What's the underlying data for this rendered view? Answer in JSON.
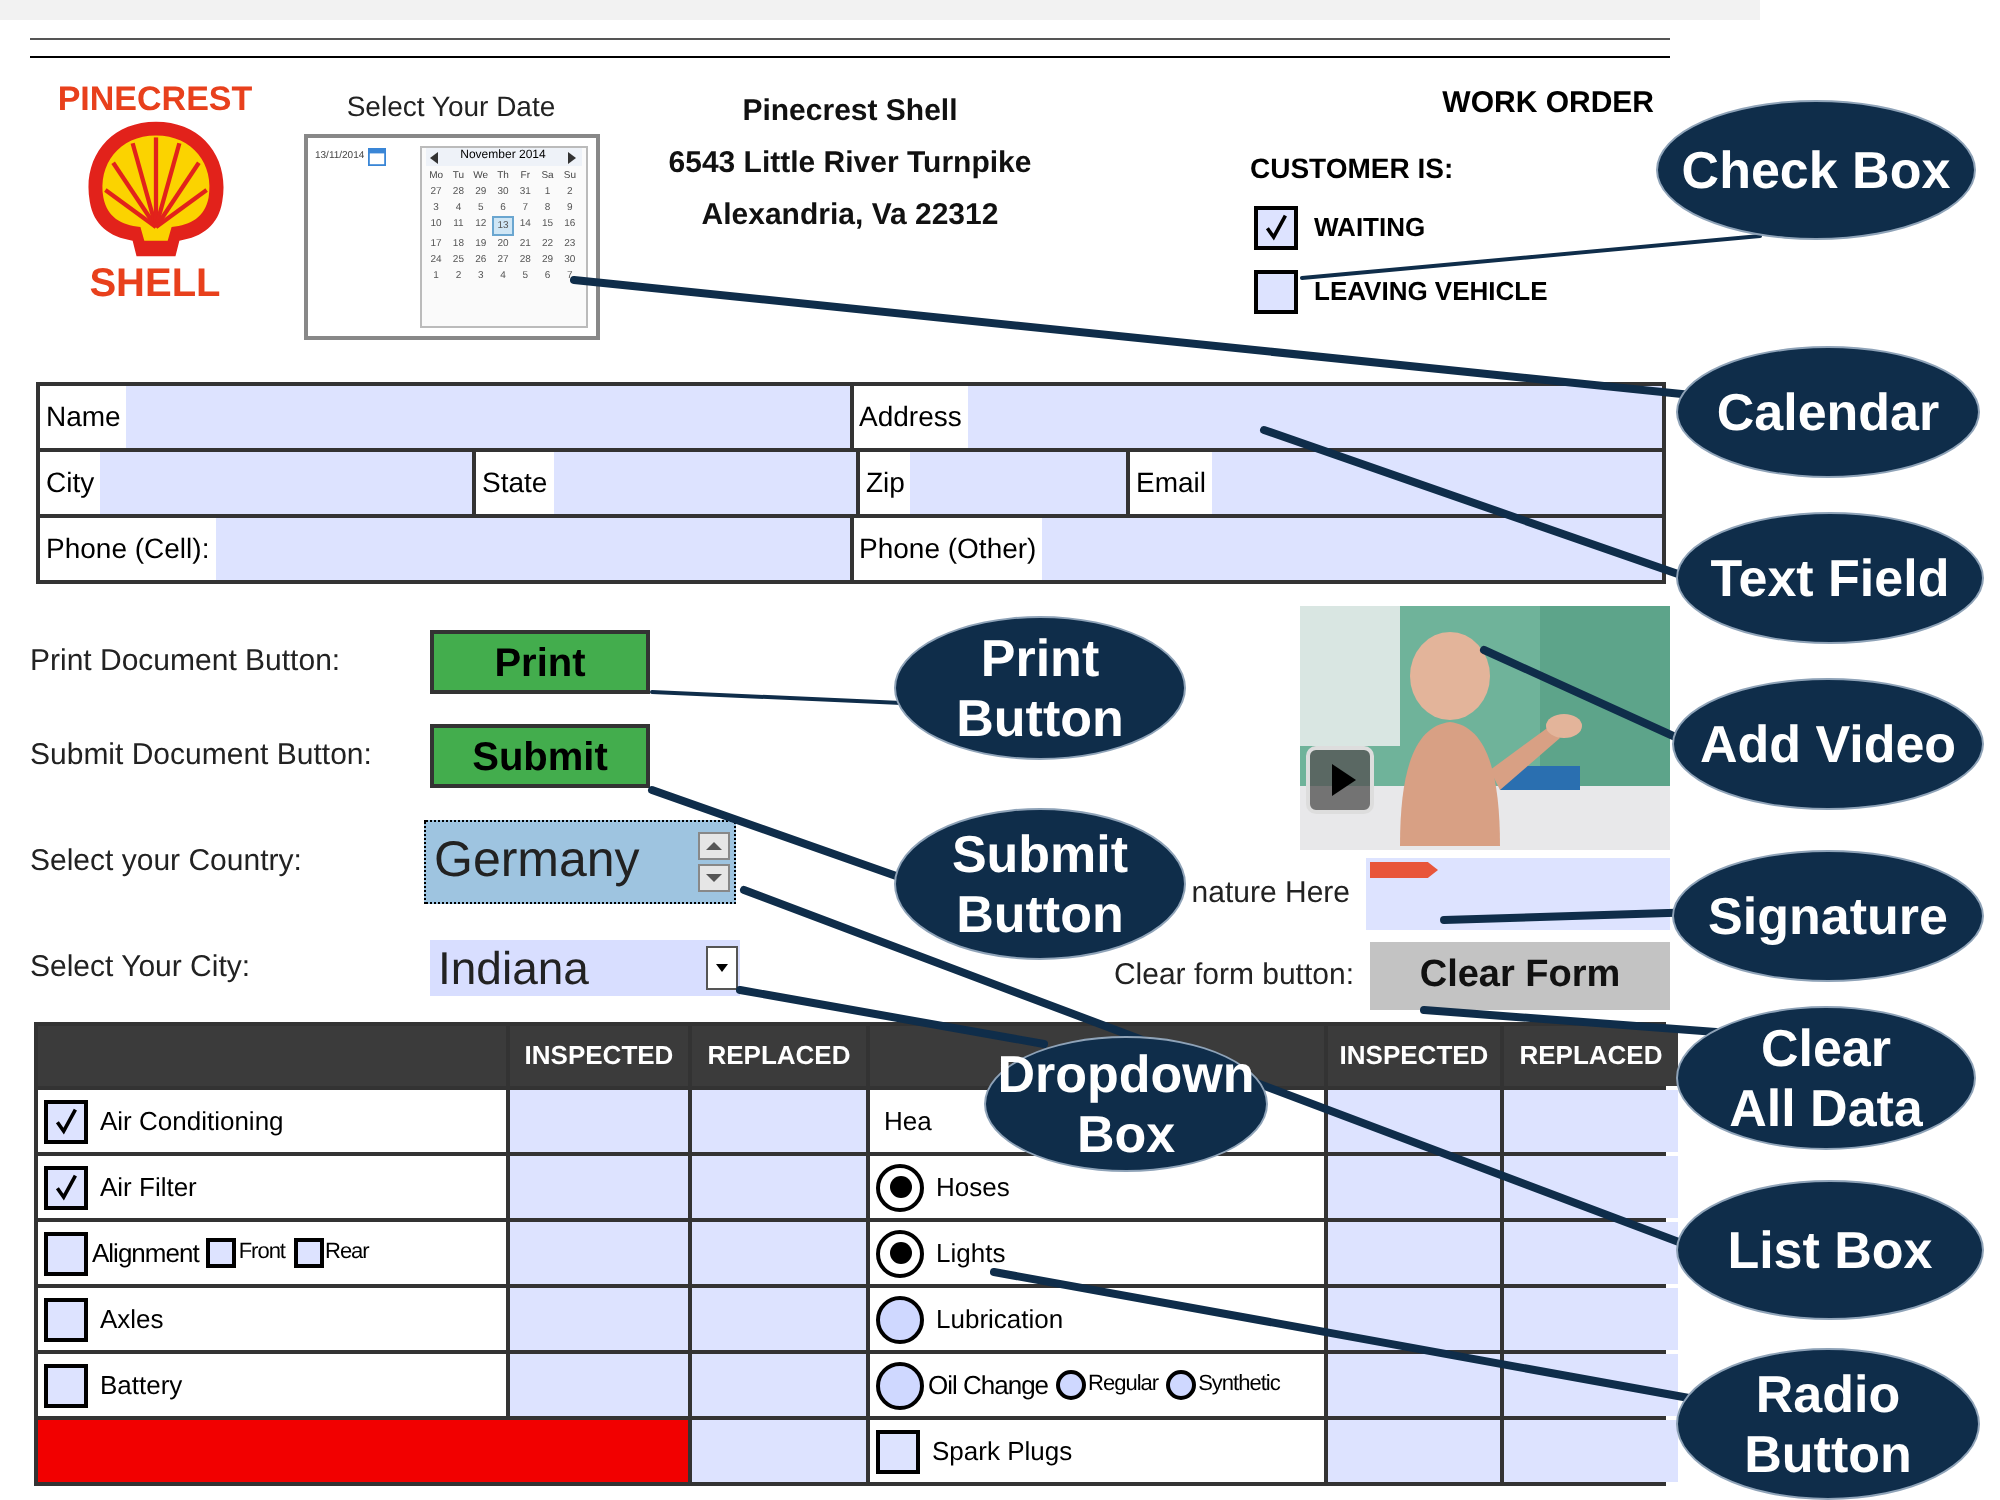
{
  "brand": {
    "top": "PINECREST",
    "bottom": "SHELL"
  },
  "date_picker": {
    "label": "Select Your Date",
    "value": "13/11/2014",
    "month": "November 2014",
    "weekdays": [
      "Mo",
      "Tu",
      "We",
      "Th",
      "Fr",
      "Sa",
      "Su"
    ],
    "weeks": [
      [
        {
          "day": "27",
          "selected": false
        },
        {
          "day": "28",
          "selected": false
        },
        {
          "day": "29",
          "selected": false
        },
        {
          "day": "30",
          "selected": false
        },
        {
          "day": "31",
          "selected": false
        },
        {
          "day": "1",
          "selected": false
        },
        {
          "day": "2",
          "selected": false
        }
      ],
      [
        {
          "day": "3",
          "selected": false
        },
        {
          "day": "4",
          "selected": false
        },
        {
          "day": "5",
          "selected": false
        },
        {
          "day": "6",
          "selected": false
        },
        {
          "day": "7",
          "selected": false
        },
        {
          "day": "8",
          "selected": false
        },
        {
          "day": "9",
          "selected": false
        }
      ],
      [
        {
          "day": "10",
          "selected": false
        },
        {
          "day": "11",
          "selected": false
        },
        {
          "day": "12",
          "selected": false
        },
        {
          "day": "13",
          "selected": true
        },
        {
          "day": "14",
          "selected": false
        },
        {
          "day": "15",
          "selected": false
        },
        {
          "day": "16",
          "selected": false
        }
      ],
      [
        {
          "day": "17",
          "selected": false
        },
        {
          "day": "18",
          "selected": false
        },
        {
          "day": "19",
          "selected": false
        },
        {
          "day": "20",
          "selected": false
        },
        {
          "day": "21",
          "selected": false
        },
        {
          "day": "22",
          "selected": false
        },
        {
          "day": "23",
          "selected": false
        }
      ],
      [
        {
          "day": "24",
          "selected": false
        },
        {
          "day": "25",
          "selected": false
        },
        {
          "day": "26",
          "selected": false
        },
        {
          "day": "27",
          "selected": false
        },
        {
          "day": "28",
          "selected": false
        },
        {
          "day": "29",
          "selected": false
        },
        {
          "day": "30",
          "selected": false
        }
      ],
      [
        {
          "day": "1",
          "selected": false
        },
        {
          "day": "2",
          "selected": false
        },
        {
          "day": "3",
          "selected": false
        },
        {
          "day": "4",
          "selected": false
        },
        {
          "day": "5",
          "selected": false
        },
        {
          "day": "6",
          "selected": false
        },
        {
          "day": "7",
          "selected": false
        }
      ]
    ]
  },
  "address": [
    "Pinecrest Shell",
    "6543 Little River Turnpike",
    "Alexandria, Va 22312"
  ],
  "title": "WORK ORDER",
  "customer": {
    "label": "CUSTOMER IS:",
    "options": [
      {
        "label": "WAITING",
        "checked": true
      },
      {
        "label": "LEAVING VEHICLE",
        "checked": false
      }
    ]
  },
  "customer_fields": [
    [
      {
        "label": "Name"
      },
      {
        "label": "Address"
      }
    ],
    [
      {
        "label": "City"
      },
      {
        "label": "State"
      },
      {
        "label": "Zip"
      },
      {
        "label": "Email"
      }
    ],
    [
      {
        "label": "Phone (Cell):"
      },
      {
        "label": "Phone (Other)"
      }
    ]
  ],
  "controls": [
    {
      "kind": "button",
      "label": "Print Document Button:",
      "text": "Print"
    },
    {
      "kind": "button",
      "label": "Submit Document Button:",
      "text": "Submit"
    },
    {
      "kind": "listbox",
      "label": "Select your Country:",
      "text": "Germany"
    },
    {
      "kind": "dropdown",
      "label": "Select Your City:",
      "text": "Indiana"
    }
  ],
  "video": {
    "kind": "picture"
  },
  "signature": {
    "label": "nature Here"
  },
  "clear": {
    "label": "Clear form button:",
    "text": "Clear Form"
  },
  "checklist": {
    "halves": [
      {
        "columns": [
          "INSPECTED",
          "REPLACED"
        ],
        "rows": [
          {
            "kind": "checkbox",
            "label": "Air Conditioning",
            "checked": true
          },
          {
            "kind": "checkbox",
            "label": "Air Filter",
            "checked": true
          },
          {
            "kind": "checkbox",
            "label": "Alignment",
            "checked": false,
            "options": [
              {
                "label": "Front",
                "checked": false
              },
              {
                "label": "Rear",
                "checked": false
              }
            ]
          },
          {
            "kind": "checkbox",
            "label": "Axles",
            "checked": false
          },
          {
            "kind": "checkbox",
            "label": "Battery",
            "checked": false
          },
          {
            "kind": "bar",
            "color": "#f20000"
          }
        ]
      },
      {
        "columns": [
          "INSPECTED",
          "REPLACED"
        ],
        "rows": [
          {
            "kind": "text",
            "label": "Hea"
          },
          {
            "kind": "radio",
            "label": "Hoses",
            "selected": true
          },
          {
            "kind": "radio",
            "label": "Lights",
            "selected": true
          },
          {
            "kind": "radio",
            "label": "Lubrication",
            "selected": false
          },
          {
            "kind": "radio",
            "label": "Oil Change",
            "selected": false,
            "options": [
              {
                "label": "Regular",
                "selected": false
              },
              {
                "label": "Synthetic",
                "selected": false
              }
            ]
          },
          {
            "kind": "checkbox",
            "label": "Spark Plugs",
            "checked": false
          }
        ]
      }
    ]
  },
  "callouts": [
    {
      "text": "Check Box"
    },
    {
      "text": "Calendar"
    },
    {
      "text": "Text Field"
    },
    {
      "text": "Print\nButton"
    },
    {
      "text": "Add Video"
    },
    {
      "text": "Submit\nButton"
    },
    {
      "text": "Signature"
    },
    {
      "text": "Clear\nAll Data"
    },
    {
      "text": "Dropdown\nBox"
    },
    {
      "text": "List Box"
    },
    {
      "text": "Radio\nButton"
    }
  ]
}
